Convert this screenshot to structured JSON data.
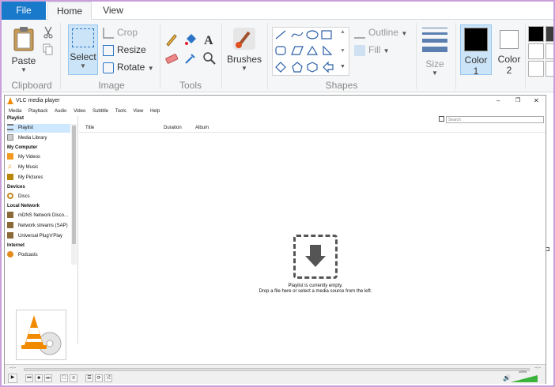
{
  "paint": {
    "tabs": [
      {
        "label": "File"
      },
      {
        "label": "Home"
      },
      {
        "label": "View"
      }
    ],
    "clipboard": {
      "paste_label": "Paste",
      "group_label": "Clipboard"
    },
    "image": {
      "select_label": "Select",
      "crop_label": "Crop",
      "resize_label": "Resize",
      "rotate_label": "Rotate",
      "group_label": "Image"
    },
    "tools": {
      "group_label": "Tools"
    },
    "brushes": {
      "label": "Brushes"
    },
    "shapes": {
      "outline_label": "Outline",
      "fill_label": "Fill",
      "group_label": "Shapes"
    },
    "size": {
      "label": "Size"
    },
    "colors": {
      "color1_label": "Color",
      "color1_num": "1",
      "color2_label": "Color",
      "color2_num": "2",
      "color1_value": "#000000",
      "color2_value": "#ffffff",
      "palette": [
        "#000000",
        "#ffffff",
        "#ffffff",
        "#ffffff"
      ]
    }
  },
  "vlc": {
    "title": "VLC media player",
    "menu": [
      "Media",
      "Playback",
      "Audio",
      "Video",
      "Subtitle",
      "Tools",
      "View",
      "Help"
    ],
    "sidebar": {
      "sections": {
        "playlist": "Playlist",
        "my_computer": "My Computer",
        "devices": "Devices",
        "local_network": "Local Network",
        "internet": "Internet"
      },
      "items": {
        "playlist": "Playlist",
        "media_library": "Media Library",
        "my_videos": "My Videos",
        "my_music": "My Music",
        "my_pictures": "My Pictures",
        "discs": "Discs",
        "mdns": "mDNS Network Disco...",
        "sap": "Network streams (SAP)",
        "upnp": "Universal Plug'n'Play",
        "podcasts": "Podcasts"
      }
    },
    "playlist": {
      "columns": [
        "Title",
        "Duration",
        "Album"
      ],
      "search_placeholder": "Search",
      "empty_line1": "Playlist is currently empty.",
      "empty_line2": "Drop a file here or select a media source from the left."
    },
    "controls": {
      "time_elapsed": "--:--",
      "time_total": "--:--",
      "volume": "100%",
      "volume_level": 1.0
    }
  }
}
